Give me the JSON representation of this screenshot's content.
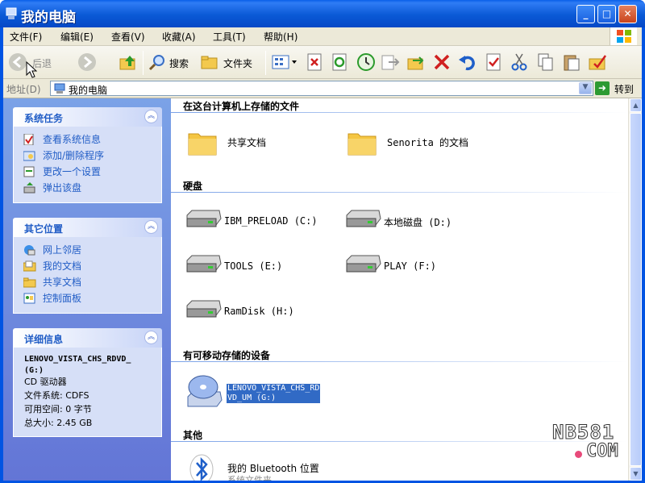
{
  "window": {
    "title": "我的电脑",
    "min": "_",
    "max": "□",
    "close": "✕"
  },
  "menus": [
    "文件(F)",
    "编辑(E)",
    "查看(V)",
    "收藏(A)",
    "工具(T)",
    "帮助(H)"
  ],
  "toolbar": {
    "back": "后退",
    "search": "搜索",
    "folders": "文件夹"
  },
  "address": {
    "label": "地址(D)",
    "value": "我的电脑",
    "go": "转到"
  },
  "sidebar": {
    "system_tasks": {
      "title": "系统任务",
      "items": [
        "查看系统信息",
        "添加/删除程序",
        "更改一个设置",
        "弹出该盘"
      ]
    },
    "other_places": {
      "title": "其它位置",
      "items": [
        "网上邻居",
        "我的文档",
        "共享文档",
        "控制面板"
      ]
    },
    "details": {
      "title": "详细信息",
      "name": "LENOVO_VISTA_CHS_RDVD_",
      "drive": "(G:)",
      "type": "CD 驱动器",
      "fs": "文件系统: CDFS",
      "free": "可用空间: 0 字节",
      "total": "总大小: 2.45 GB"
    }
  },
  "content": {
    "groups": [
      "在这台计算机上存储的文件",
      "硬盘",
      "有可移动存储的设备",
      "其他"
    ],
    "files": [
      "共享文档",
      "Senorita 的文档"
    ],
    "drives": [
      "IBM_PRELOAD (C:)",
      "本地磁盘 (D:)",
      "TOOLS (E:)",
      "PLAY (F:)",
      "RamDisk (H:)"
    ],
    "removable": {
      "line1": "LENOVO_VISTA_CHS_RD",
      "line2": "VD_UM (G:)"
    },
    "other": {
      "name": "我的 Bluetooth 位置",
      "sub": "系统文件夹"
    }
  },
  "watermark": {
    "top": "NB581",
    "bottom": "COM"
  },
  "colors": {
    "title": "#0054e3",
    "sidepane": "#6f8fe0",
    "select": "#316ac5"
  }
}
